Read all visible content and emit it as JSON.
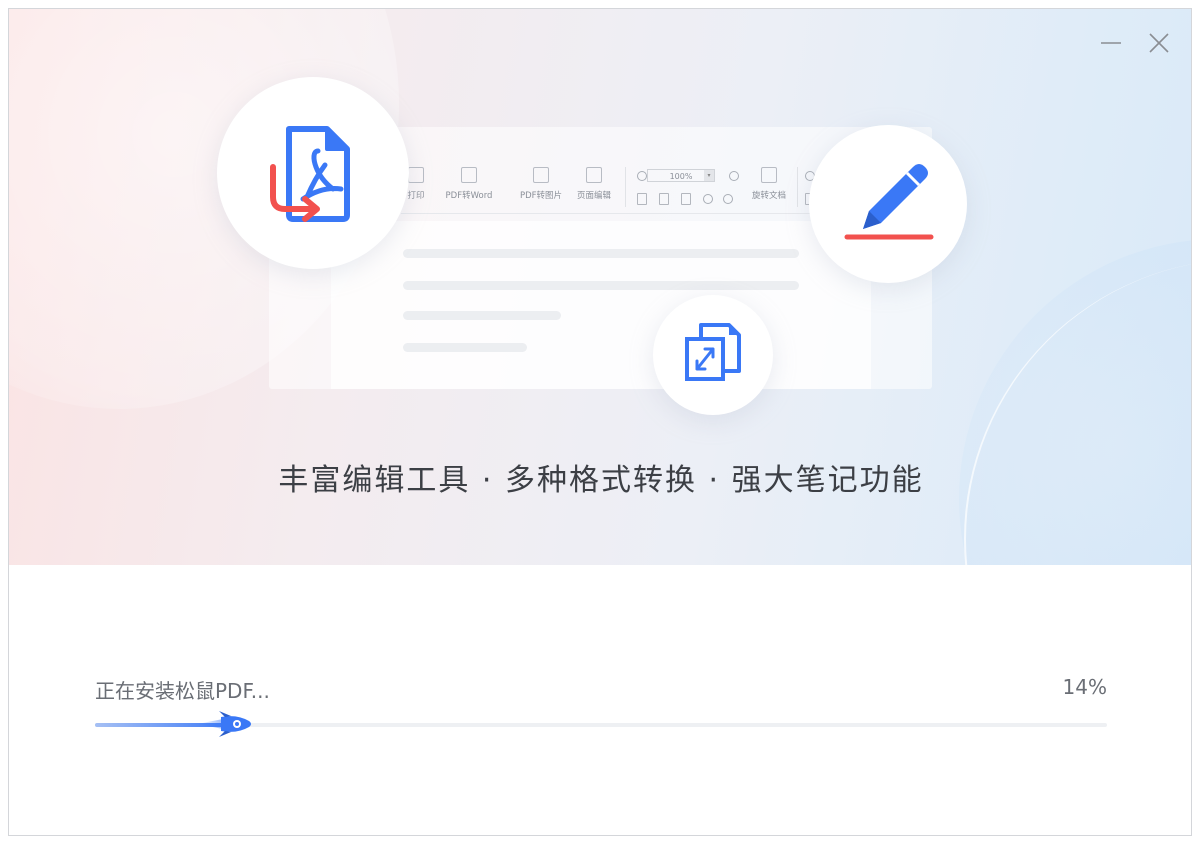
{
  "window": {
    "minimize_label": "minimize",
    "close_label": "close"
  },
  "hero": {
    "slogan": "丰富编辑工具 · 多种格式转换 · 强大笔记功能",
    "mock_toolbar": {
      "items": [
        "打印",
        "PDF转Word",
        "PDF转图片",
        "页面编辑",
        "旋转文档"
      ],
      "zoom": "100%"
    },
    "icons": {
      "convert": "pdf-convert-icon",
      "note": "pen-annotate-icon",
      "edit": "file-resize-icon"
    }
  },
  "install": {
    "status_text": "正在安装松鼠PDF...",
    "percent_text": "14%",
    "progress": 0.14
  },
  "colors": {
    "accent_blue": "#3a78f6",
    "accent_red": "#f2514e"
  }
}
